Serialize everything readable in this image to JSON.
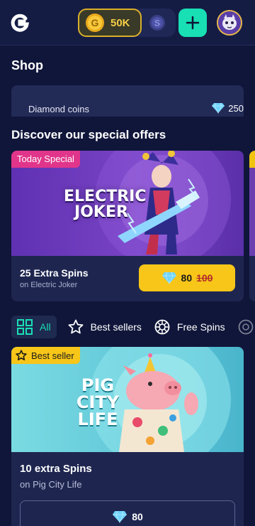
{
  "header": {
    "logo_icon": "g-logo-icon",
    "coin_balance": "50K",
    "coin_icon": "gold-coin-icon",
    "token_icon": "s-token-icon",
    "add_icon": "plus-icon",
    "avatar_icon": "cat-avatar-icon",
    "colors": {
      "accent": "#19dfb5",
      "gold": "#f5cf45"
    }
  },
  "shop": {
    "title": "Shop",
    "diamond_label": "Diamond coins",
    "diamond_balance": "250"
  },
  "offers": {
    "title": "Discover our special offers",
    "featured": {
      "badge": "Today Special",
      "game_logo_line1": "ELECTRIC",
      "game_logo_line2": "JOKER",
      "title": "25 Extra Spins",
      "subtitle": "on Electric Joker",
      "price": "80",
      "old_price": "100"
    }
  },
  "filters": {
    "tabs": [
      {
        "label": "All",
        "icon": "grid-icon",
        "active": true
      },
      {
        "label": "Best sellers",
        "icon": "star-icon",
        "active": false
      },
      {
        "label": "Free Spins",
        "icon": "roulette-icon",
        "active": false
      }
    ]
  },
  "products": [
    {
      "badge": "Best seller",
      "game_logo_line1": "PIG",
      "game_logo_line2": "CITY",
      "game_logo_line3": "LIFE",
      "title": "10 extra Spins",
      "subtitle": "on Pig City Life",
      "price": "80"
    }
  ]
}
